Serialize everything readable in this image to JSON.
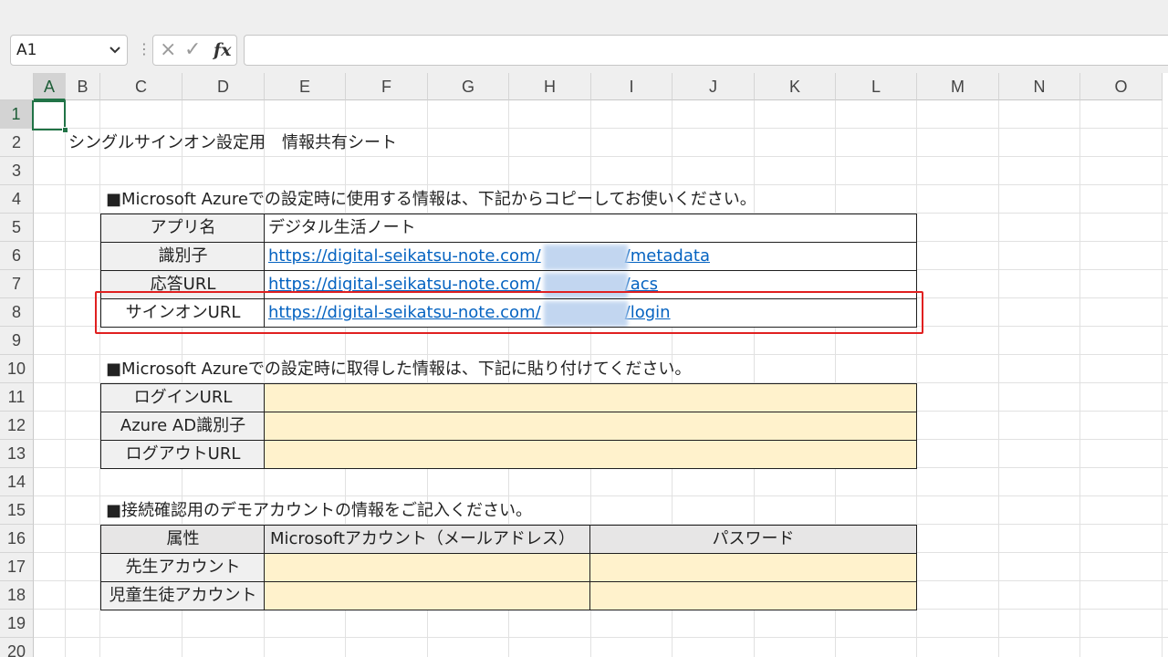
{
  "formula_bar": {
    "name_box": "A1",
    "dropdown_icon": "chevron-down-icon",
    "separator_icon": "vertical-dots-icon",
    "cancel_icon": "×",
    "enter_icon": "✓",
    "fx_label": "fx",
    "formula_value": ""
  },
  "columns": [
    "A",
    "B",
    "C",
    "D",
    "E",
    "F",
    "G",
    "H",
    "I",
    "J",
    "K",
    "L",
    "M",
    "N",
    "O"
  ],
  "rows": [
    "1",
    "2",
    "3",
    "4",
    "5",
    "6",
    "7",
    "8",
    "9",
    "10",
    "11",
    "12",
    "13",
    "14",
    "15",
    "16",
    "17",
    "18",
    "19",
    "20"
  ],
  "selected_cell": "A1",
  "sheet": {
    "title": "シングルサインオン設定用　情報共有シート",
    "section1": {
      "heading": "■Microsoft Azureでの設定時に使用する情報は、下記からコピーしてお使いください。",
      "rows": [
        {
          "label": "アプリ名",
          "value": "デジタル生活ノート"
        },
        {
          "label": "識別子",
          "value_prefix": "https://digital-seikatsu-note.com/",
          "value_suffix": "/metadata"
        },
        {
          "label": "応答URL",
          "value_prefix": "https://digital-seikatsu-note.com/",
          "value_suffix": "/acs"
        },
        {
          "label": "サインオンURL",
          "value_prefix": "https://digital-seikatsu-note.com/",
          "value_suffix": "/login"
        }
      ]
    },
    "section2": {
      "heading": "■Microsoft Azureでの設定時に取得した情報は、下記に貼り付けてください。",
      "rows": [
        {
          "label": "ログインURL",
          "value": ""
        },
        {
          "label": "Azure AD識別子",
          "value": ""
        },
        {
          "label": "ログアウトURL",
          "value": ""
        }
      ]
    },
    "section3": {
      "heading": "■接続確認用のデモアカウントの情報をご記入ください。",
      "headers": [
        "属性",
        "Microsoftアカウント（メールアドレス）",
        "パスワード"
      ],
      "rows": [
        {
          "label": "先生アカウント",
          "email": "",
          "password": ""
        },
        {
          "label": "児童生徒アカウント",
          "email": "",
          "password": ""
        }
      ]
    }
  },
  "colors": {
    "input_fill": "#fff2cc",
    "header_fill": "#e7e6e6",
    "link": "#0563c1",
    "highlight": "#e02020",
    "selection": "#217346"
  }
}
